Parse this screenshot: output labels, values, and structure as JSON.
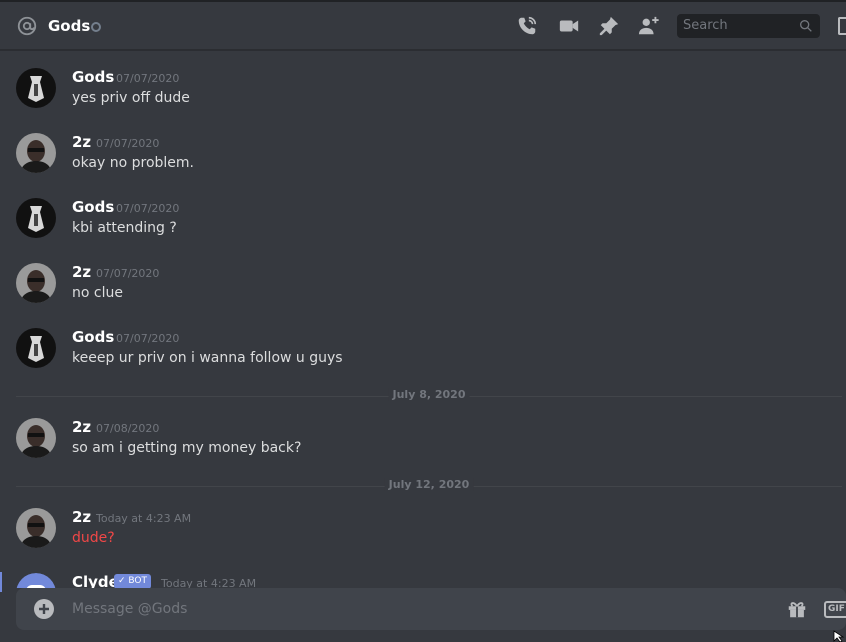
{
  "header": {
    "channel_name": "Gods",
    "search_placeholder": "Search"
  },
  "messages": [
    {
      "author": "Gods",
      "timestamp": "07/07/2020",
      "text": "yes priv off dude"
    },
    {
      "author": "2z",
      "timestamp": "07/07/2020",
      "text": "okay no problem."
    },
    {
      "author": "Gods",
      "timestamp": "07/07/2020",
      "text": "kbi attending ?"
    },
    {
      "author": "2z",
      "timestamp": "07/07/2020",
      "text": "no clue"
    },
    {
      "author": "Gods",
      "timestamp": "07/07/2020",
      "text": "keeep ur priv on i wanna follow u guys"
    },
    {
      "author": "2z",
      "timestamp": "07/08/2020",
      "text": "so am i getting my money back?"
    },
    {
      "author": "2z",
      "timestamp": "Today at 4:23 AM",
      "text": "dude?"
    },
    {
      "author": "Clyde",
      "timestamp": "Today at 4:23 AM",
      "bot_tag": "✓ BOT"
    }
  ],
  "dividers": [
    "July 8, 2020",
    "July 12, 2020"
  ],
  "composer": {
    "placeholder": "Message @Gods",
    "gif_label": "GIF"
  },
  "colors": {
    "background": "#36393f",
    "error_text": "#f04747",
    "bot_tag": "#7289da"
  }
}
